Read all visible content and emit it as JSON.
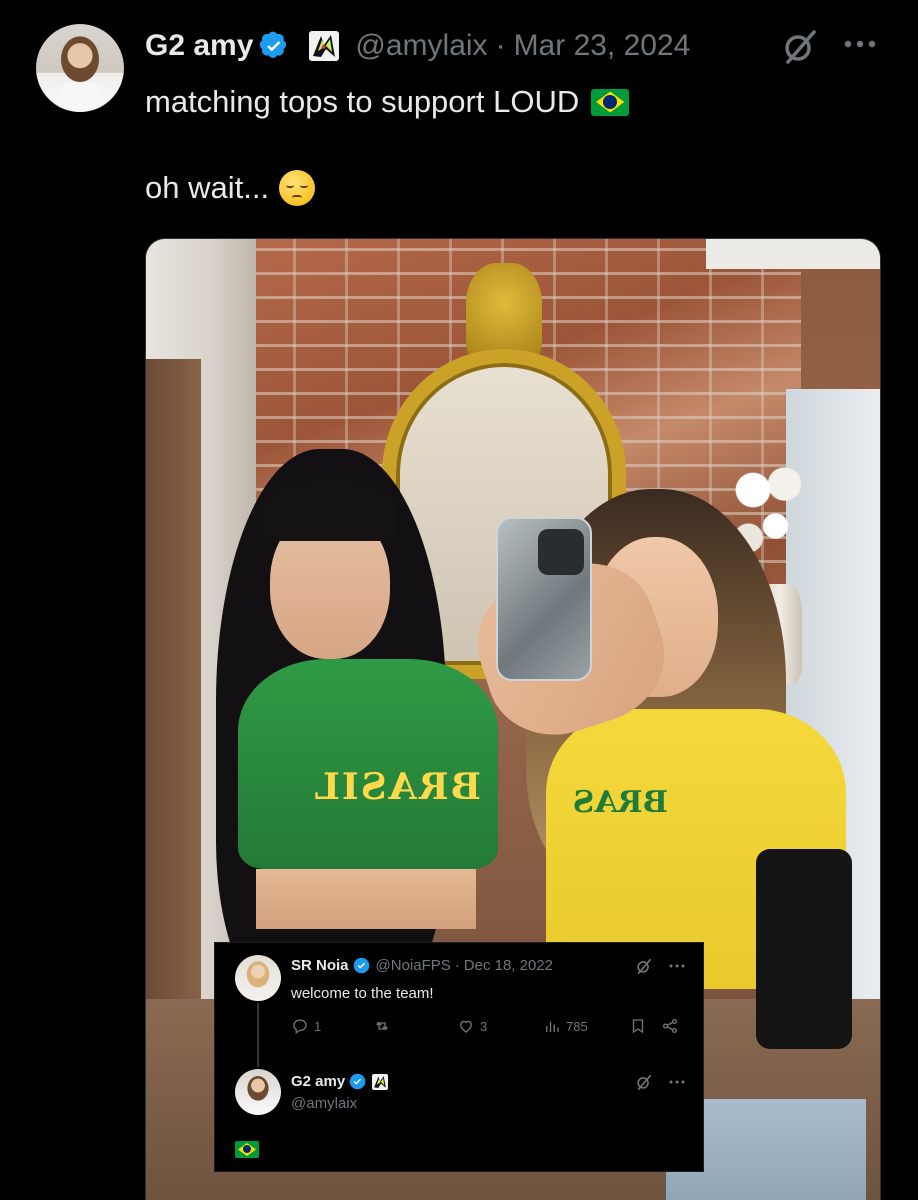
{
  "tweet": {
    "display_name": "G2 amy",
    "handle": "@amylaix",
    "separator": "·",
    "date": "Mar 23, 2024",
    "text_line1": "matching tops to support LOUD",
    "text_line2": "oh wait...",
    "verified": true,
    "icons": [
      "verified-badge-icon",
      "affiliate-badge-icon",
      "grok-icon",
      "more-icon",
      "brazil-flag-emoji",
      "pensive-face-emoji"
    ],
    "accent_color": "#1d9bf0"
  },
  "photo": {
    "shirt_print_left": "BRASIL",
    "shirt_print_right": "BRAS"
  },
  "quoted": {
    "post1": {
      "display_name": "SR Noia",
      "handle": "@NoiaFPS",
      "separator": "·",
      "date": "Dec 18, 2022",
      "text": "welcome to the team!",
      "replies": "1",
      "retweets": "",
      "likes": "3",
      "views": "785"
    },
    "post2": {
      "display_name": "G2 amy",
      "handle": "@amylaix",
      "text_emoji": "brazil-flag"
    }
  }
}
